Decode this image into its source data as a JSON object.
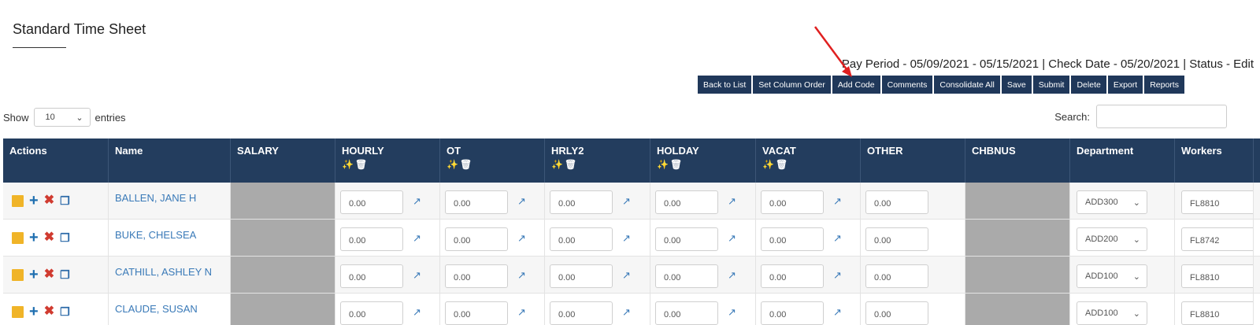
{
  "page": {
    "title": "Standard Time Sheet",
    "pay_info": "Pay Period - 05/09/2021 - 05/15/2021 | Check Date - 05/20/2021 | Status - Edit"
  },
  "toolbar": [
    {
      "name": "back-to-list-button",
      "label": "Back to List"
    },
    {
      "name": "set-column-order-button",
      "label": "Set Column Order"
    },
    {
      "name": "add-code-button",
      "label": "Add Code"
    },
    {
      "name": "comments-button",
      "label": "Comments"
    },
    {
      "name": "consolidate-all-button",
      "label": "Consolidate All"
    },
    {
      "name": "save-button",
      "label": "Save"
    },
    {
      "name": "submit-button",
      "label": "Submit"
    },
    {
      "name": "delete-button",
      "label": "Delete"
    },
    {
      "name": "export-button",
      "label": "Export"
    },
    {
      "name": "reports-button",
      "label": "Reports"
    }
  ],
  "list_controls": {
    "show_label": "Show",
    "entries_value": "10",
    "entries_label": "entries",
    "search_label": "Search:"
  },
  "columns": [
    {
      "key": "actions",
      "label": "Actions",
      "tools": false
    },
    {
      "key": "name",
      "label": "Name",
      "tools": false
    },
    {
      "key": "salary",
      "label": "SALARY",
      "tools": false
    },
    {
      "key": "hourly",
      "label": "HOURLY",
      "tools": true
    },
    {
      "key": "ot",
      "label": "OT",
      "tools": true
    },
    {
      "key": "hrly2",
      "label": "HRLY2",
      "tools": true
    },
    {
      "key": "holday",
      "label": "HOLDAY",
      "tools": true
    },
    {
      "key": "vacat",
      "label": "VACAT",
      "tools": true
    },
    {
      "key": "other",
      "label": "OTHER",
      "tools": false
    },
    {
      "key": "chbnus",
      "label": "CHBNUS",
      "tools": false
    },
    {
      "key": "department",
      "label": "Department",
      "tools": false
    },
    {
      "key": "workers",
      "label": "Workers",
      "tools": false
    }
  ],
  "rows": [
    {
      "name": "BALLEN, JANE H",
      "hourly": "0.00",
      "ot": "0.00",
      "hrly2": "0.00",
      "holday": "0.00",
      "vacat": "0.00",
      "other": "0.00",
      "department": "ADD300",
      "workers": "FL8810"
    },
    {
      "name": "BUKE, CHELSEA",
      "hourly": "0.00",
      "ot": "0.00",
      "hrly2": "0.00",
      "holday": "0.00",
      "vacat": "0.00",
      "other": "0.00",
      "department": "ADD200",
      "workers": "FL8742"
    },
    {
      "name": "CATHILL, ASHLEY N",
      "hourly": "0.00",
      "ot": "0.00",
      "hrly2": "0.00",
      "holday": "0.00",
      "vacat": "0.00",
      "other": "0.00",
      "department": "ADD100",
      "workers": "FL8810"
    },
    {
      "name": "CLAUDE, SUSAN",
      "hourly": "0.00",
      "ot": "0.00",
      "hrly2": "0.00",
      "holday": "0.00",
      "vacat": "0.00",
      "other": "0.00",
      "department": "ADD100",
      "workers": "FL8810"
    }
  ],
  "icons": {
    "note": "sticky-note-icon",
    "add": "plus-icon",
    "remove": "x-icon",
    "copy": "copy-icon",
    "wand": "magic-wand-icon",
    "trash": "trash-icon",
    "external": "external-link-icon"
  },
  "colors": {
    "header_bg": "#233d5e",
    "button_bg": "#20385a",
    "link": "#3a7ab8",
    "disabled_cell": "#aaaaaa",
    "note_icon": "#f0b428",
    "delete_icon": "#d03b30",
    "annotation_arrow": "#e02020"
  }
}
